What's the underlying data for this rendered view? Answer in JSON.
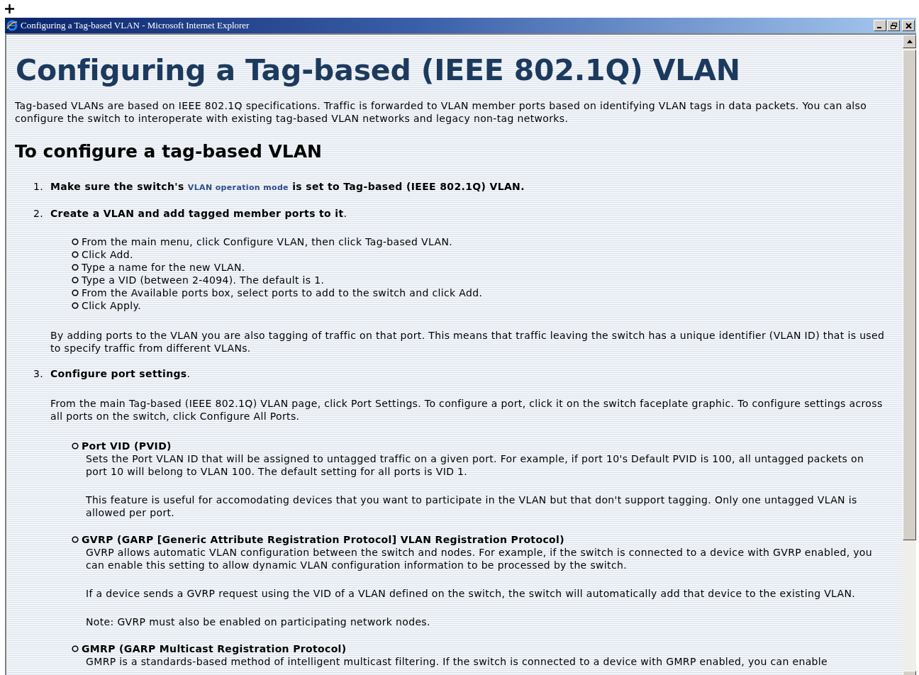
{
  "window": {
    "title": "Configuring a Tag-based VLAN - Microsoft Internet Explorer"
  },
  "heading": "Configuring a Tag-based (IEEE 802.1Q) VLAN",
  "intro": "Tag-based VLANs are based on IEEE 802.1Q specifications. Traffic is forwarded to VLAN member ports based on identifying VLAN tags in data packets. You can also configure the switch to interoperate with existing tag-based VLAN networks and legacy non-tag networks.",
  "subheading": "To configure a tag-based VLAN",
  "steps": [
    {
      "number": "1.",
      "text_before": "Make sure the switch's",
      "link": "VLAN operation mode",
      "text_after": "is set to Tag-based (IEEE 802.1Q) VLAN."
    },
    {
      "number": "2.",
      "title": "**Create a VLAN and add tagged member ports to it**.",
      "substeps": [
        "From the main menu, click Configure VLAN, then click Tag-based VLAN.",
        "Click Add.",
        "Type a name for the new VLAN.",
        "Type a VID (between 2-4094). The default is 1.",
        "From the Available ports box, select ports to add to the switch and click Add.",
        "Click Apply."
      ],
      "note": "By adding ports to the VLAN you are also tagging of traffic on that port. This means that traffic leaving the switch has a unique identifier (VLAN ID) that is used to specify traffic from different VLANs."
    },
    {
      "number": "3.",
      "title": "**Configure port settings**.",
      "note": "From the main Tag-based (IEEE 802.1Q) VLAN page, click Port Settings. To configure a port, click it on the switch faceplate graphic. To configure settings across all ports on the switch, click Configure All Ports.",
      "options": [
        {
          "title": "Port VID (PVID)",
          "paragraphs": [
            "Sets the Port VLAN ID that will be assigned to untagged traffic on a given port. For example, if port 10's Default PVID is 100, all untagged packets on port 10 will belong to VLAN 100. The default setting for all ports is VID 1.",
            "This feature is useful for accomodating devices that you want to participate in the VLAN but that don't support tagging. Only one untagged VLAN is allowed per port."
          ]
        },
        {
          "title": "GVRP (GARP [Generic Attribute Registration Protocol] VLAN Registration Protocol)",
          "paragraphs": [
            "GVRP allows automatic VLAN configuration between the switch and nodes. For example, if the switch is connected to a device with GVRP enabled, you can enable this setting to allow dynamic VLAN configuration information to be processed by the switch.",
            "If a device sends a GVRP request using the VID of a VLAN defined on the switch, the switch will automatically add that device to the existing VLAN.",
            "Note: GVRP must also be enabled on participating network nodes."
          ]
        },
        {
          "title": "GMRP (GARP Multicast Registration Protocol)",
          "paragraphs": [
            "GMRP is a standards-based method of intelligent multicast filtering. If the switch is connected to a device with GMRP enabled, you can enable"
          ]
        }
      ]
    }
  ]
}
